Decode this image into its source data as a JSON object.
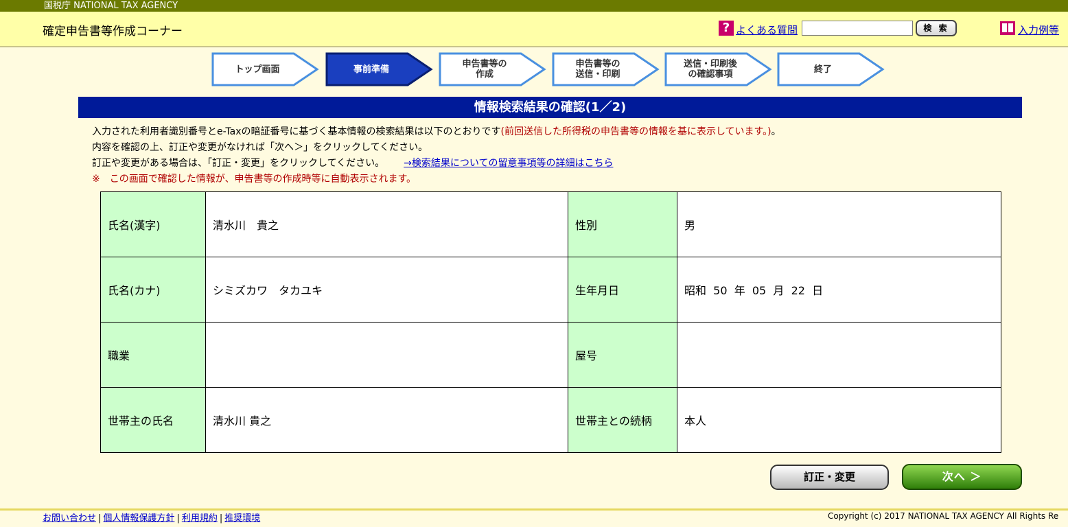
{
  "agency": {
    "name": "国税庁  NATIONAL TAX AGENCY"
  },
  "header": {
    "title": "確定申告書等作成コーナー",
    "faq_icon": "?",
    "faq_label": "よくある質問",
    "search_value": "",
    "search_button": "検 索",
    "example_label": "入力例等"
  },
  "steps": [
    {
      "label": "トップ画面",
      "state": "done"
    },
    {
      "label": "事前準備",
      "state": "current"
    },
    {
      "label": "申告書等の\n作成",
      "state": "todo"
    },
    {
      "label": "申告書等の\n送信・印刷",
      "state": "todo"
    },
    {
      "label": "送信・印刷後\nの確認事項",
      "state": "todo"
    },
    {
      "label": "終了",
      "state": "todo"
    }
  ],
  "section": {
    "title": "情報検索結果の確認(1／2)"
  },
  "instructions": {
    "line1": "入力された利用者識別番号とe-Taxの暗証番号に基づく基本情報の検索結果は以下のとおりです",
    "line1_note": "(前回送信した所得税の申告書等の情報を基に表示しています。)",
    "line1_end": "。",
    "line2": "内容を確認の上、訂正や変更がなければ「次へ＞」をクリックしてください。",
    "line3": "訂正や変更がある場合は、「訂正・変更」をクリックしてください。",
    "details_link": "→検索結果についての留意事項等の詳細はこちら",
    "note": "※　この画面で確認した情報が、申告書等の作成時等に自動表示されます。"
  },
  "info": {
    "rows": [
      {
        "label1": "氏名(漢字)",
        "value1": "清水川　貴之",
        "label2": "性別",
        "value2": "男"
      },
      {
        "label1": "氏名(カナ)",
        "value1": "シミズカワ　タカユキ",
        "label2": "生年月日",
        "value2": "昭和  50  年  05  月  22  日"
      },
      {
        "label1": "職業",
        "value1": "",
        "label2": "屋号",
        "value2": ""
      },
      {
        "label1": "世帯主の氏名",
        "value1": "清水川 貴之",
        "label2": "世帯主との続柄",
        "value2": "本人"
      }
    ]
  },
  "buttons": {
    "correct": "訂正・変更",
    "next": "次へ ＞"
  },
  "footer": {
    "links": [
      "お問い合わせ",
      "個人情報保護方針",
      "利用規約",
      "推奨環境"
    ],
    "copyright": "Copyright (c) 2017 NATIONAL TAX AGENCY All Rights Re"
  },
  "colors": {
    "agency_bar": "#6b7a00",
    "header_bg": "#ffffa8",
    "page_bg": "#fffbe0",
    "section_bar": "#001a99",
    "table_header": "#ccffcc",
    "step_current": "#1a3fbf",
    "step_border": "#4a90e0",
    "next_button": "#3b8a10"
  }
}
